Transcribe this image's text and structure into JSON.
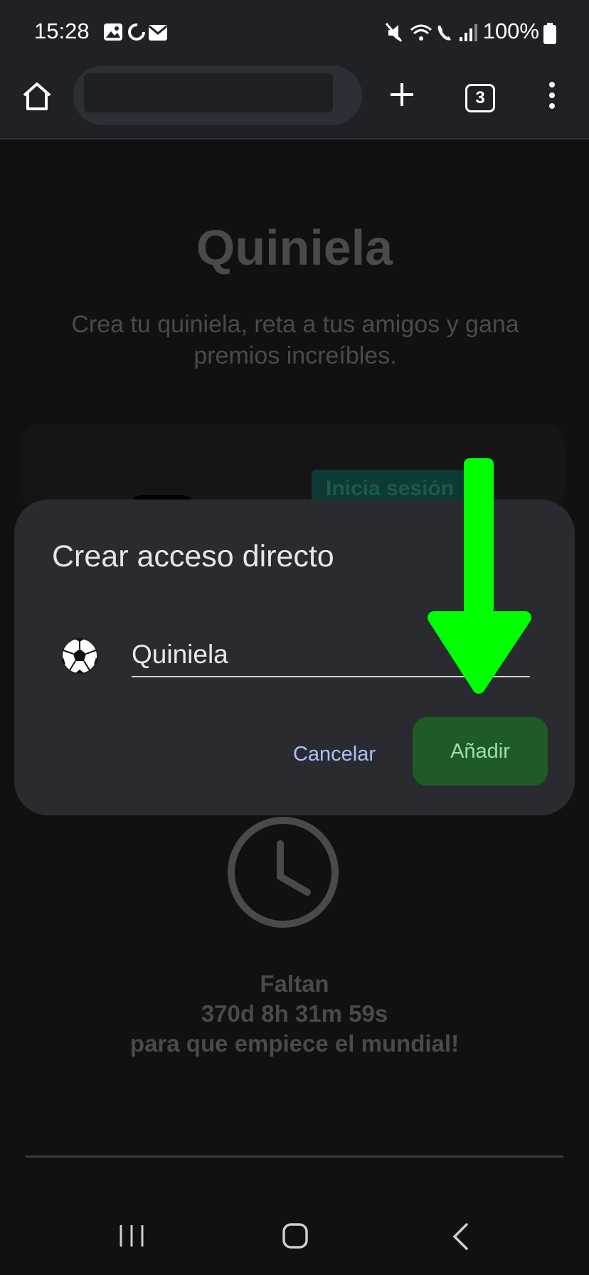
{
  "status_bar": {
    "time": "15:28",
    "battery": "100%"
  },
  "browser": {
    "tab_count": "3"
  },
  "page": {
    "title": "Quiniela",
    "subtitle": "Crea tu quiniela, reta a tus amigos y gana premios increíbles.",
    "login_button": "Inicia sesión",
    "countdown": {
      "line1": "Faltan",
      "line2": "370d 8h 31m 59s",
      "line3": "para que empiece el mundial!"
    }
  },
  "dialog": {
    "title": "Crear acceso directo",
    "name_value": "Quiniela",
    "cancel_label": "Cancelar",
    "add_label": "Añadir"
  },
  "colors": {
    "accent_green": "#1e5b28",
    "arrow_green": "#00ff00",
    "link_blue": "#a9c2f7"
  }
}
